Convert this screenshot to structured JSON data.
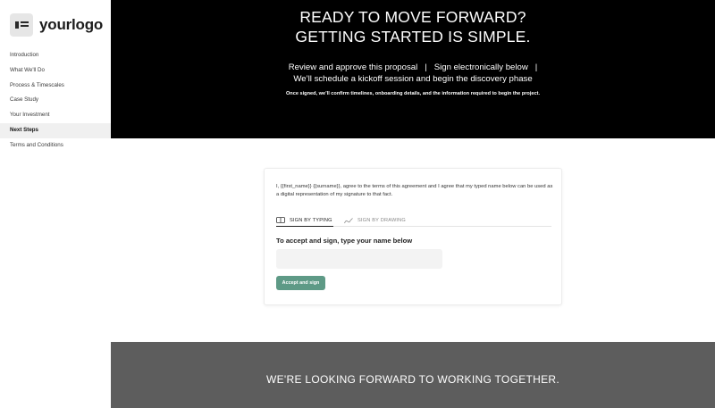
{
  "brand": {
    "logo_text": "yourlogo",
    "logo_icon": "logo-mark-icon"
  },
  "sidebar": {
    "items": [
      {
        "label": "Introduction",
        "active": false
      },
      {
        "label": "What We'll Do",
        "active": false
      },
      {
        "label": "Process & Timescales",
        "active": false
      },
      {
        "label": "Case Study",
        "active": false
      },
      {
        "label": "Your Investment",
        "active": false
      },
      {
        "label": "Next Steps",
        "active": true
      },
      {
        "label": "Terms and Conditions",
        "active": false
      }
    ]
  },
  "hero": {
    "title_line1": "READY TO MOVE FORWARD?",
    "title_line2": "GETTING STARTED IS SIMPLE.",
    "steps_line1": "Review and approve this proposal   |   Sign electronically below   |",
    "steps_line2": "We’ll schedule a kickoff session and begin the discovery phase",
    "note": "Once signed, we’ll confirm timelines, onboarding details, and the information required to begin the project."
  },
  "signature": {
    "agreement": "I, {{first_name}} {{surname}}, agree to the terms of this agreement and I agree that my typed name below can be used as a digital representation of my signature to that fact.",
    "tabs": [
      {
        "label": "SIGN BY TYPING",
        "icon": "keyboard-icon",
        "selected": true
      },
      {
        "label": "SIGN BY DRAWING",
        "icon": "draw-icon",
        "selected": false
      }
    ],
    "prompt": "To accept and sign, type your name below",
    "name_value": "",
    "name_placeholder": "",
    "accept_label": "Accept and sign"
  },
  "footer": {
    "text": "WE'RE LOOKING FORWARD TO WORKING TOGETHER."
  },
  "colors": {
    "hero_bg": "#000000",
    "accent_button": "#5e9a86",
    "footer_bg": "#5d5d5d"
  }
}
